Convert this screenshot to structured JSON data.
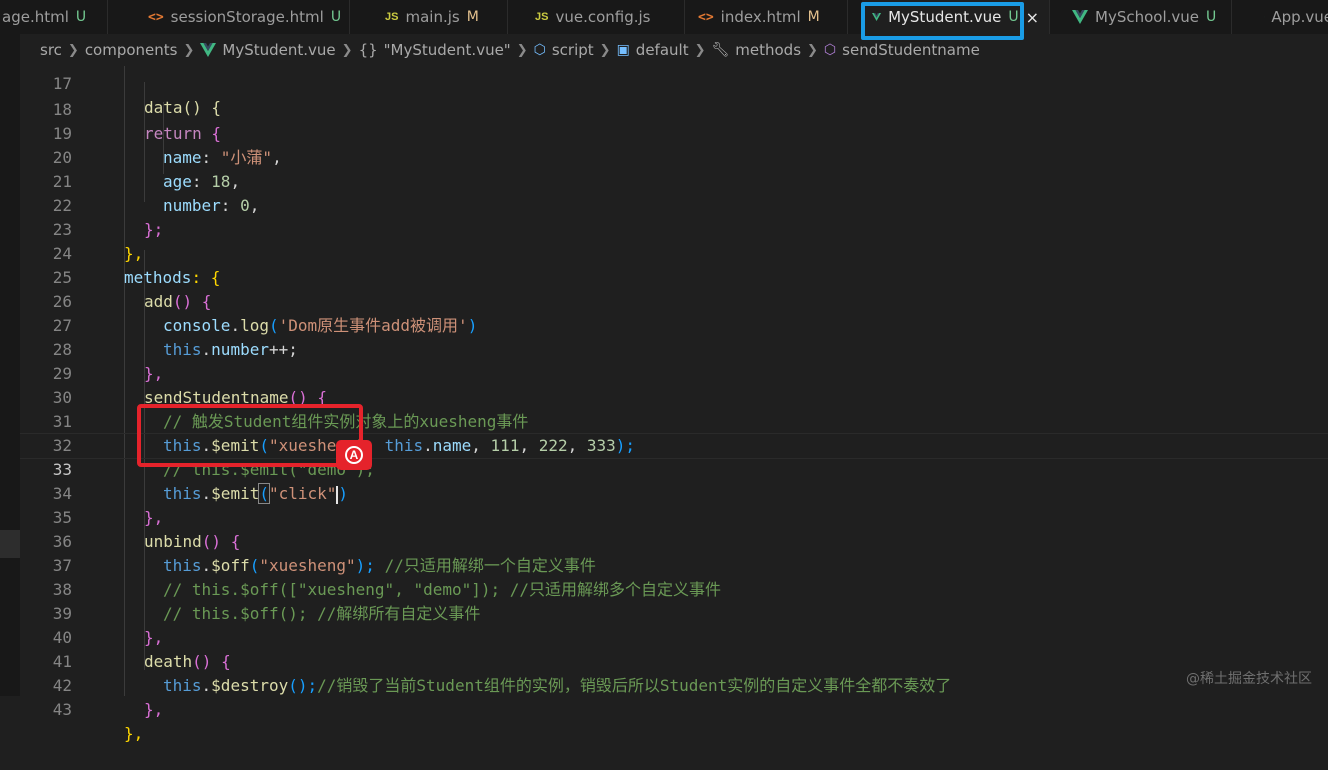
{
  "tabs": [
    {
      "label": "age.html",
      "status": "U",
      "type": "html",
      "active": false
    },
    {
      "label": "sessionStorage.html",
      "status": "U",
      "type": "html",
      "active": false
    },
    {
      "label": "main.js",
      "status": "M",
      "type": "js",
      "active": false
    },
    {
      "label": "vue.config.js",
      "status": "",
      "type": "js",
      "active": false
    },
    {
      "label": "index.html",
      "status": "M",
      "type": "html",
      "active": false
    },
    {
      "label": "MyStudent.vue",
      "status": "U",
      "type": "vue",
      "active": true
    },
    {
      "label": "MySchool.vue",
      "status": "U",
      "type": "vue",
      "active": false
    },
    {
      "label": "App.vue",
      "status": "",
      "type": "vue",
      "active": false
    }
  ],
  "icons": {
    "html": "<>",
    "js": "JS",
    "close": "×"
  },
  "breadcrumb": {
    "src": "src",
    "components": "components",
    "file": "MyStudent.vue",
    "obj_icon": "{}",
    "obj": "\"MyStudent.vue\"",
    "script": "script",
    "default": "default",
    "methods": "methods",
    "method": "sendStudentname"
  },
  "code": {
    "l17": {
      "num": "17",
      "a": "data() {"
    },
    "l18": {
      "num": "18",
      "a": "return",
      "b": " {"
    },
    "l19": {
      "num": "19",
      "a": "name",
      "b": ": ",
      "c": "\"小蒲\"",
      "d": ","
    },
    "l20": {
      "num": "20",
      "a": "age",
      "b": ": ",
      "c": "18",
      "d": ","
    },
    "l21": {
      "num": "21",
      "a": "number",
      "b": ": ",
      "c": "0",
      "d": ","
    },
    "l22": {
      "num": "22",
      "a": "};"
    },
    "l23": {
      "num": "23",
      "a": "},"
    },
    "l24": {
      "num": "24",
      "a": "methods",
      "b": ": {"
    },
    "l25": {
      "num": "25",
      "a": "add",
      "b": "() {"
    },
    "l26": {
      "num": "26",
      "a": "console",
      "b": ".",
      "c": "log",
      "d": "(",
      "e": "'Dom原生事件add被调用'",
      "f": ")"
    },
    "l27": {
      "num": "27",
      "a": "this",
      "b": ".",
      "c": "number",
      "d": "++;"
    },
    "l28": {
      "num": "28",
      "a": "},"
    },
    "l29": {
      "num": "29",
      "a": "sendStudentname",
      "b": "() {"
    },
    "l30": {
      "num": "30",
      "a": "// 触发Student组件实例对象上的xuesheng事件"
    },
    "l31": {
      "num": "31",
      "a": "this",
      "b": ".",
      "c": "$emit",
      "d": "(",
      "e": "\"xuesheng\"",
      "f": ", ",
      "g": "this",
      "h": ".",
      "i": "name",
      "j": ", ",
      "k": "111",
      "l": ", ",
      "m": "222",
      "n": ", ",
      "o": "333",
      "p": ");"
    },
    "l32": {
      "num": "32",
      "a": "// this.$emit(\"demo\");"
    },
    "l33": {
      "num": "33",
      "a": "this",
      "b": ".",
      "c": "$emit",
      "d": "(",
      "e": "\"click\"",
      "f": ")"
    },
    "l34": {
      "num": "34",
      "a": "},"
    },
    "l35": {
      "num": "35",
      "a": "unbind",
      "b": "() {"
    },
    "l36": {
      "num": "36",
      "a": "this",
      "b": ".",
      "c": "$off",
      "d": "(",
      "e": "\"xuesheng\"",
      "f": ");",
      "g": " //只适用解绑一个自定义事件"
    },
    "l37": {
      "num": "37",
      "a": "// this.$off([\"xuesheng\", \"demo\"]); //只适用解绑多个自定义事件"
    },
    "l38": {
      "num": "38",
      "a": "// this.$off(); //解绑所有自定义事件"
    },
    "l39": {
      "num": "39",
      "a": "},"
    },
    "l40": {
      "num": "40",
      "a": "death",
      "b": "() {"
    },
    "l41": {
      "num": "41",
      "a": "this",
      "b": ".",
      "c": "$destroy",
      "d": "();",
      "e": "//销毁了当前Student组件的实例，销毁后所以Student实例的自定义事件全都不奏效了"
    },
    "l42": {
      "num": "42",
      "a": "},"
    },
    "l43": {
      "num": "43",
      "a": "},"
    }
  },
  "watermark": "@稀土掘金技术社区"
}
